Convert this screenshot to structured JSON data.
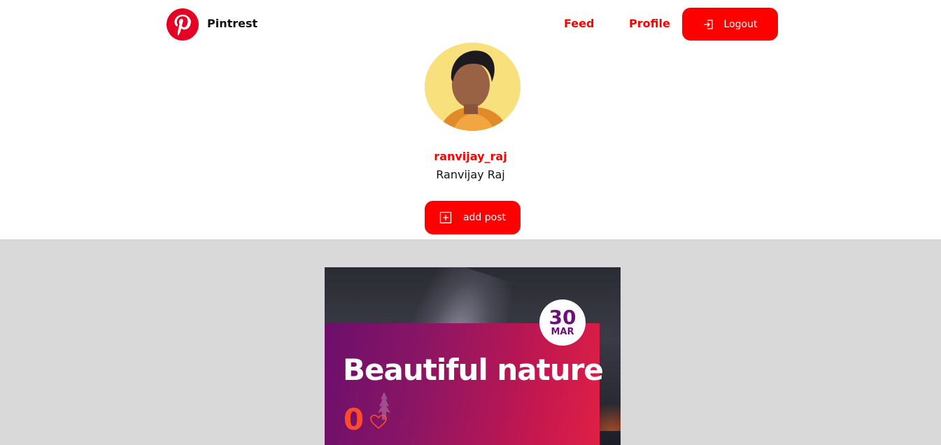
{
  "navbar": {
    "brand": "Pintrest",
    "links": {
      "feed": "Feed",
      "profile": "Profile"
    },
    "logout_label": "Logout",
    "accent_color": "#ff0000"
  },
  "profile": {
    "username": "ranvijay_raj",
    "full_name": "Ranvijay Raj",
    "add_post_label": "add post"
  },
  "posts": [
    {
      "title": "Beautiful nature",
      "date_day": "30",
      "date_month": "MAR",
      "likes": "0"
    }
  ],
  "icons": {
    "logo": "pinterest-logo-icon",
    "logout": "logout-icon",
    "add": "plus-square-icon",
    "like": "heart-icon"
  }
}
